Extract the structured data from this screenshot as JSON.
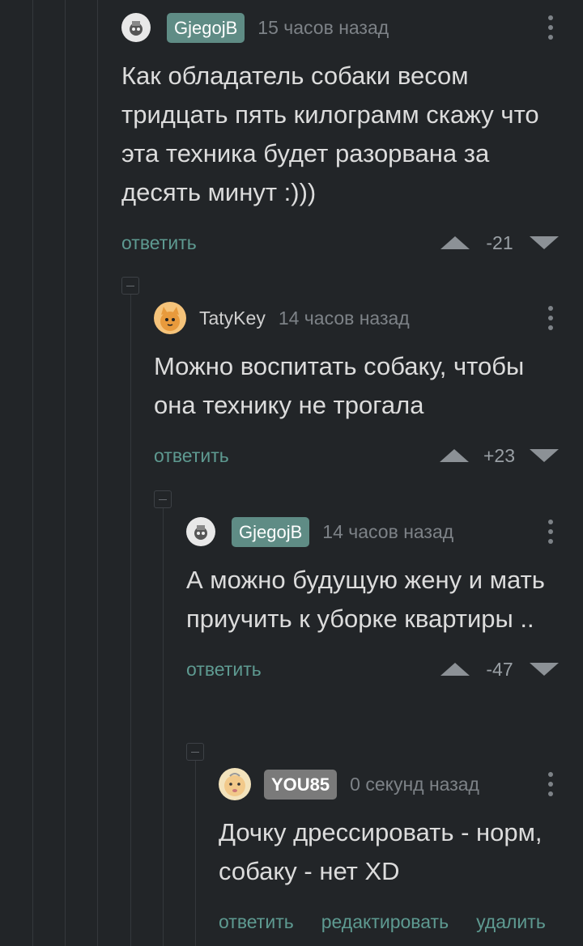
{
  "comments": [
    {
      "author": "GjegojB",
      "time": "15 часов назад",
      "text": "Как обладатель собаки весом тридцать пять килограмм скажу что эта техника будет разорвана за десять минут :)))",
      "reply_label": "ответить",
      "score": "-21",
      "avatar_icon": "robot-avatar-icon"
    },
    {
      "author": "TatyKey",
      "time": "14 часов назад",
      "text": "Можно воспитать собаку, чтобы она технику не трогала",
      "reply_label": "ответить",
      "score": "+23",
      "avatar_icon": "cat-avatar-icon"
    },
    {
      "author": "GjegojB",
      "time": "14 часов назад",
      "text": "А можно будущую жену и мать приучить к уборке квартиры ..",
      "reply_label": "ответить",
      "score": "-47",
      "avatar_icon": "robot-avatar-icon"
    },
    {
      "author": "YOU85",
      "time": "0 секунд назад",
      "text": "Дочку дрессировать - норм, собаку - нет XD",
      "reply_label": "ответить",
      "edit_label": "редактировать",
      "delete_label": "удалить",
      "avatar_icon": "baby-avatar-icon"
    }
  ],
  "colors": {
    "background": "#222528",
    "author_badge": "#5f8c85",
    "own_badge": "#7a7a7a",
    "link": "#5e9a91"
  }
}
